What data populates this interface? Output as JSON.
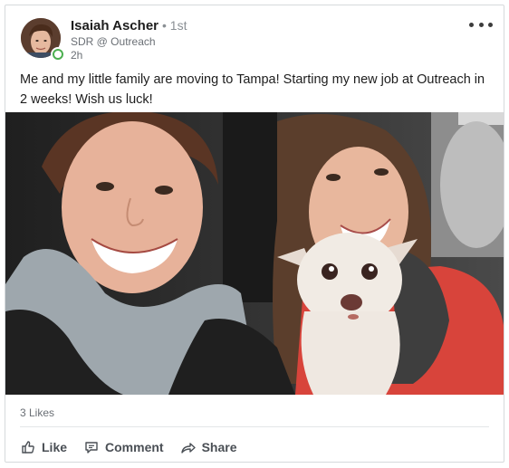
{
  "post": {
    "author": {
      "name": "Isaiah Ascher",
      "degree": "• 1st",
      "headline": "SDR @ Outreach",
      "time": "2h",
      "online": true
    },
    "text": "Me and my little family are moving to Tampa! Starting my new job at Outreach in 2 weeks! Wish us luck!",
    "photo_icon": "photo-image",
    "likes": "3 Likes"
  },
  "actions": {
    "like_label": "Like",
    "comment_label": "Comment",
    "share_label": "Share"
  },
  "icons": {
    "more": "more-icon",
    "like": "thumbs-up-icon",
    "comment": "comment-icon",
    "share": "share-icon"
  },
  "colors": {
    "online": "#4caf50",
    "text": "#1d1d1d",
    "muted": "#6a6f75",
    "action": "#4a4f55",
    "border": "#d6d9dc"
  }
}
